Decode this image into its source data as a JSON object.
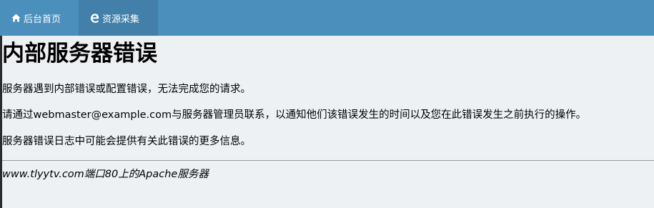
{
  "nav": {
    "tabs": [
      {
        "label": "后台首页",
        "icon": "home-icon"
      },
      {
        "label": "资源采集",
        "icon": "edge-icon"
      }
    ],
    "colors": {
      "bar": "#4b8fbd",
      "active_tab": "#427fa9"
    }
  },
  "error_page": {
    "title": "内部服务器错误",
    "paragraphs": [
      "服务器遇到内部错误或配置错误，无法完成您的请求。",
      "请通过webmaster@example.com与服务器管理员联系，以通知他们该错误发生的时间以及您在此错误发生之前执行的操作。",
      "服务器错误日志中可能会提供有关此错误的更多信息。"
    ],
    "address": "www.tlyytv.com端口80上的Apache服务器"
  }
}
